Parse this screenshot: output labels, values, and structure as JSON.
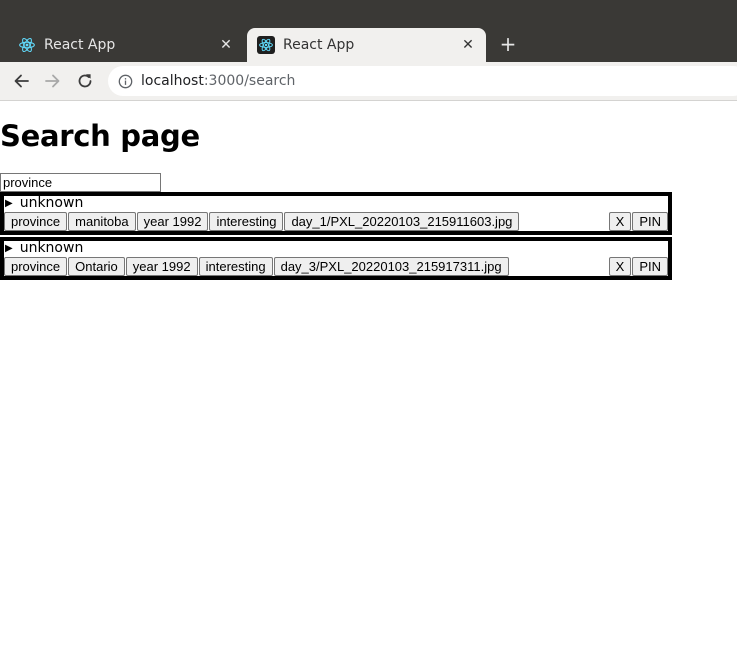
{
  "browser": {
    "tabs": [
      {
        "title": "React App",
        "active": false
      },
      {
        "title": "React App",
        "active": true
      }
    ],
    "new_tab_label": "+",
    "close_label": "✕",
    "url_host": "localhost",
    "url_path": ":3000/search"
  },
  "page": {
    "heading": "Search page",
    "search_value": "province"
  },
  "results": [
    {
      "summary": "unknown",
      "tags": [
        "province",
        "manitoba",
        "year 1992",
        "interesting",
        "day_1/PXL_20220103_215911603.jpg"
      ],
      "remove_label": "X",
      "pin_label": "PIN"
    },
    {
      "summary": "unknown",
      "tags": [
        "province",
        "Ontario",
        "year 1992",
        "interesting",
        "day_3/PXL_20220103_215917311.jpg"
      ],
      "remove_label": "X",
      "pin_label": "PIN"
    }
  ],
  "colors": {
    "titlebar": "#3a3936",
    "toolbar": "#f1f0ee",
    "react": "#61dafb"
  }
}
